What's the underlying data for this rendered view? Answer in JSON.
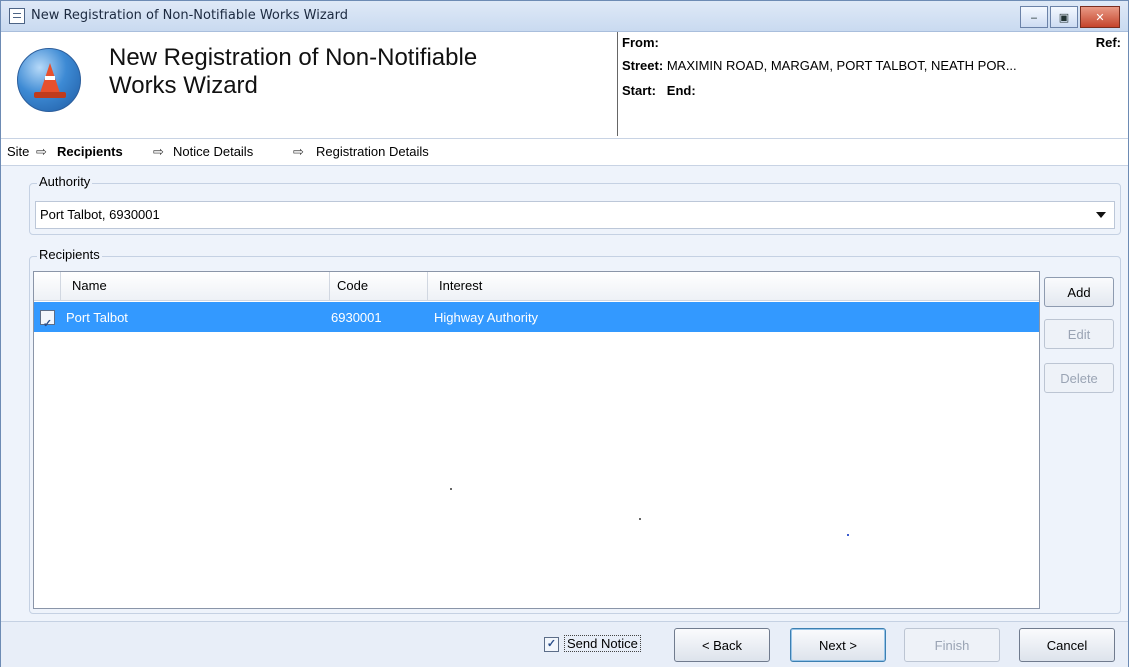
{
  "window": {
    "title": "New Registration of Non-Notifiable Works Wizard",
    "controls": {
      "minimize": "‒",
      "maximize": "▣",
      "close": "✕"
    }
  },
  "header": {
    "title_line1": "New Registration of Non-Notifiable",
    "title_line2": "Works Wizard",
    "logo_icon": "traffic-cone-icon",
    "from_label": "From:",
    "ref_label": "Ref:",
    "street_label": "Street:",
    "street_value": "MAXIMIN ROAD, MARGAM, PORT TALBOT, NEATH POR...",
    "start_label": "Start:",
    "end_label": "End:"
  },
  "breadcrumb": {
    "steps": [
      "Site",
      "Recipients",
      "Notice Details",
      "Registration Details"
    ],
    "separator": "⇨",
    "current": "Recipients"
  },
  "authority": {
    "label": "Authority",
    "selected": "Port Talbot, 6930001"
  },
  "recipients": {
    "label": "Recipients",
    "columns": [
      "Name",
      "Code",
      "Interest"
    ],
    "rows": [
      {
        "checked": true,
        "name": "Port Talbot",
        "code": "6930001",
        "interest": "Highway Authority"
      }
    ],
    "buttons": {
      "add": "Add",
      "edit": "Edit",
      "delete": "Delete"
    }
  },
  "footer": {
    "send_notice_label": "Send Notice",
    "send_notice_checked": true,
    "back": "< Back",
    "next": "Next >",
    "finish": "Finish",
    "cancel": "Cancel"
  },
  "colors": {
    "selection": "#3399ff",
    "window_border": "#6d8bb4",
    "close_button": "#c5442b"
  }
}
